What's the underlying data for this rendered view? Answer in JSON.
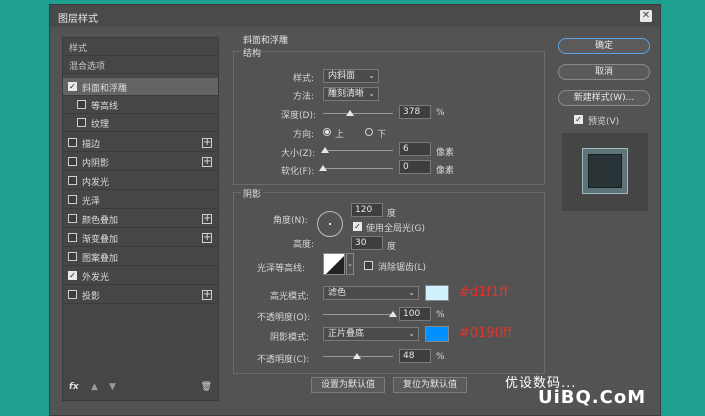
{
  "dialog": {
    "title": "图层样式"
  },
  "styles_list": {
    "header": "样式",
    "blend": "混合选项",
    "items": [
      {
        "label": "斜面和浮雕",
        "checked": true,
        "selected": true
      },
      {
        "label": "等高线",
        "checked": false,
        "sub": true
      },
      {
        "label": "纹理",
        "checked": false,
        "sub": true
      },
      {
        "label": "描边",
        "checked": false,
        "plus": true
      },
      {
        "label": "内阴影",
        "checked": false,
        "plus": true
      },
      {
        "label": "内发光",
        "checked": false
      },
      {
        "label": "光泽",
        "checked": false
      },
      {
        "label": "颜色叠加",
        "checked": false,
        "plus": true
      },
      {
        "label": "渐变叠加",
        "checked": false,
        "plus": true
      },
      {
        "label": "图案叠加",
        "checked": false
      },
      {
        "label": "外发光",
        "checked": true
      },
      {
        "label": "投影",
        "checked": false,
        "plus": true
      }
    ],
    "footer": {
      "fx": "fx"
    }
  },
  "bevel": {
    "group_title": "斜面和浮雕",
    "structure_title": "结构",
    "style_label": "样式:",
    "style_value": "内斜面",
    "technique_label": "方法:",
    "technique_value": "雕刻清晰",
    "depth_label": "深度(D):",
    "depth_value": "378",
    "depth_unit": "%",
    "depth_fraction": 0.38,
    "direction_label": "方向:",
    "dir_up": "上",
    "dir_down": "下",
    "size_label": "大小(Z):",
    "size_value": "6",
    "size_unit": "像素",
    "size_fraction": 0.03,
    "soften_label": "软化(F):",
    "soften_value": "0",
    "soften_unit": "像素",
    "soften_fraction": 0.0
  },
  "shading": {
    "title": "阴影",
    "angle_label": "角度(N):",
    "angle_value": "120",
    "angle_unit": "度",
    "global_light": "使用全局光(G)",
    "altitude_label": "高度:",
    "altitude_value": "30",
    "altitude_unit": "度",
    "gloss_label": "光泽等高线:",
    "antialias": "消除锯齿(L)",
    "highlight_label": "高光模式:",
    "highlight_mode": "滤色",
    "highlight_color": "#d1f1ff",
    "highlight_hex": "#d1f1ff",
    "hl_opacity_label": "不透明度(O):",
    "hl_opacity_value": "100",
    "hl_opacity_unit": "%",
    "hl_opacity_fraction": 1.0,
    "shadow_label": "阴影模式:",
    "shadow_mode": "正片叠底",
    "shadow_color": "#0190ff",
    "shadow_hex": "#0190ff",
    "sh_opacity_label": "不透明度(C):",
    "sh_opacity_value": "48",
    "sh_opacity_unit": "%",
    "sh_opacity_fraction": 0.48
  },
  "bottom_buttons": {
    "make_default": "设置为默认值",
    "reset_default": "复位为默认值"
  },
  "right_buttons": {
    "ok": "确定",
    "cancel": "取消",
    "new_style": "新建样式(W)...",
    "preview": "预览(V)"
  },
  "watermark": {
    "line1": "优设数码...",
    "line2": "UiBQ.CoM"
  }
}
